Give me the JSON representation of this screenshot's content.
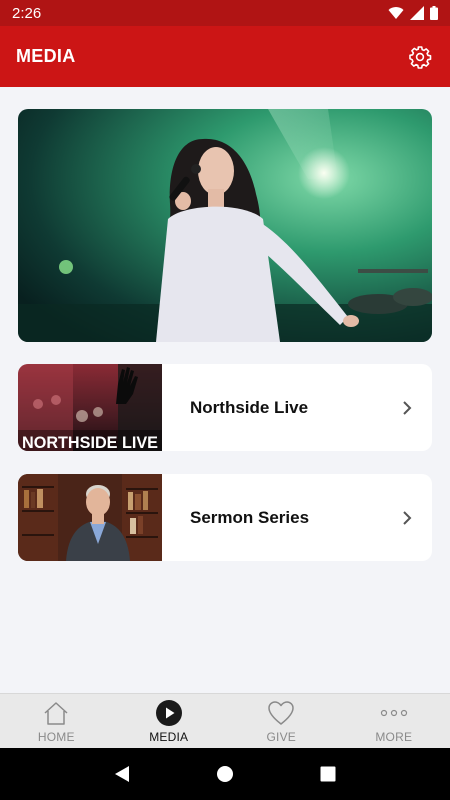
{
  "status_bar": {
    "time": "2:26"
  },
  "app_bar": {
    "title": "MEDIA"
  },
  "cards": [
    {
      "label": "Northside Live",
      "thumb_text": "NORTHSIDE LIVE"
    },
    {
      "label": "Sermon Series"
    }
  ],
  "bottom_nav": [
    {
      "label": "HOME",
      "icon": "home-icon",
      "active": false
    },
    {
      "label": "MEDIA",
      "icon": "play-circle-icon",
      "active": true
    },
    {
      "label": "GIVE",
      "icon": "heart-icon",
      "active": false
    },
    {
      "label": "MORE",
      "icon": "more-dots-icon",
      "active": false
    }
  ],
  "colors": {
    "status_bar": "#b01414",
    "app_bar": "#cc1515",
    "background": "#f3f4f8"
  }
}
